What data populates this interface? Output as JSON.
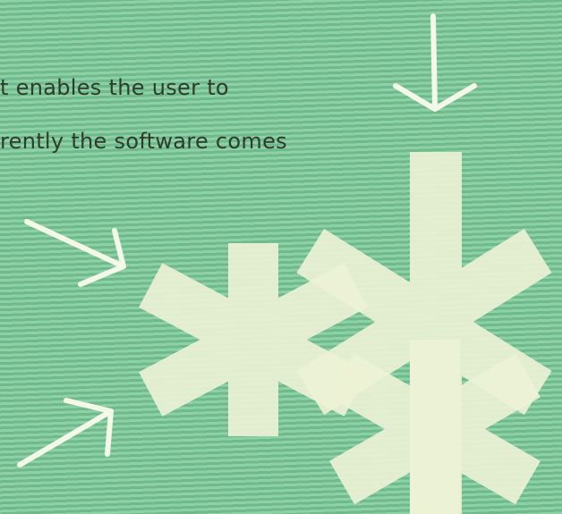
{
  "text_lines": [
    "t enables the user to",
    "rently the software comes"
  ],
  "colors": {
    "background": "#7ec49a",
    "stripe_light": "#8fd0a6",
    "stripe_dark": "#6dba8c",
    "text": "#2f3b2c",
    "shape": "#eef3d6",
    "arrow": "#f4f8e8"
  }
}
